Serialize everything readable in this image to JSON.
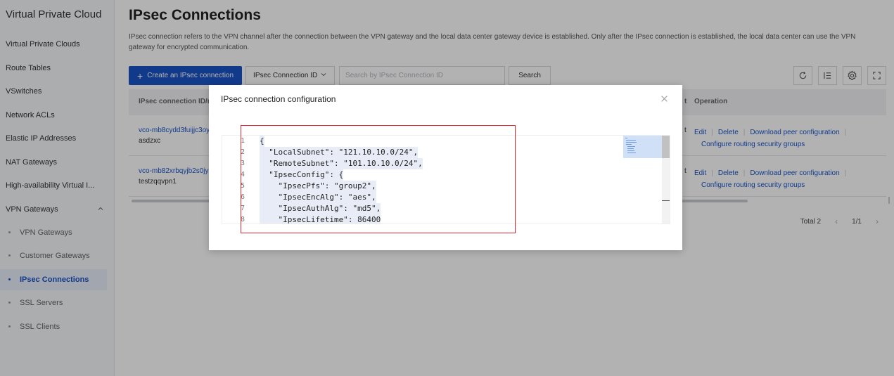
{
  "sidebar": {
    "title": "Virtual Private Cloud",
    "items": [
      {
        "label": "Virtual Private Clouds"
      },
      {
        "label": "Route Tables"
      },
      {
        "label": "VSwitches"
      },
      {
        "label": "Network ACLs"
      },
      {
        "label": "Elastic IP Addresses"
      },
      {
        "label": "NAT Gateways"
      },
      {
        "label": "High-availability Virtual I..."
      }
    ],
    "group": {
      "label": "VPN Gateways",
      "expanded_icon": "chevron-up-icon"
    },
    "sub_items": [
      {
        "label": "VPN Gateways"
      },
      {
        "label": "Customer Gateways"
      },
      {
        "label": "IPsec Connections",
        "active": true
      },
      {
        "label": "SSL Servers"
      },
      {
        "label": "SSL Clients"
      }
    ]
  },
  "page": {
    "title": "IPsec Connections",
    "description": "IPsec connection refers to the VPN channel after the connection between the VPN gateway and the local data center gateway device is established. Only after the IPsec connection is established, the local data center can use the VPN gateway for encrypted communication."
  },
  "toolbar": {
    "create_label": "Create an IPsec connection",
    "filter_select": "IPsec Connection ID",
    "search_placeholder": "Search by IPsec Connection ID",
    "search_label": "Search",
    "icons": [
      "refresh-icon",
      "list-settings-icon",
      "gear-icon",
      "fullscreen-icon"
    ]
  },
  "table": {
    "headers": {
      "id": "IPsec connection ID/n",
      "t": "t",
      "operation": "Operation"
    },
    "rows": [
      {
        "id": "vco-mb8cydd3fuijjc3oy",
        "name": "asdzxc",
        "t": "t"
      },
      {
        "id": "vco-mb82xrbqyjb2s0jy",
        "name": "testzqqvpn1",
        "t": "t"
      }
    ],
    "ops": {
      "edit": "Edit",
      "delete": "Delete",
      "download": "Download peer configuration",
      "routing": "Configure routing security groups"
    }
  },
  "pagination": {
    "total": "Total 2",
    "page": "1/1"
  },
  "modal": {
    "title": "IPsec connection configuration",
    "code_lines": [
      {
        "n": "1",
        "text": "{"
      },
      {
        "n": "2",
        "text": "  \"LocalSubnet\": \"121.10.10.0/24\","
      },
      {
        "n": "3",
        "text": "  \"RemoteSubnet\": \"101.10.10.0/24\","
      },
      {
        "n": "4",
        "text": "  \"IpsecConfig\": {"
      },
      {
        "n": "5",
        "text": "    \"IpsecPfs\": \"group2\","
      },
      {
        "n": "6",
        "text": "    \"IpsecEncAlg\": \"aes\","
      },
      {
        "n": "7",
        "text": "    \"IpsecAuthAlg\": \"md5\","
      },
      {
        "n": "8",
        "text": "    \"IpsecLifetime\": 86400"
      }
    ]
  },
  "colors": {
    "primary": "#1a54c8",
    "highlight": "#e0242a"
  }
}
